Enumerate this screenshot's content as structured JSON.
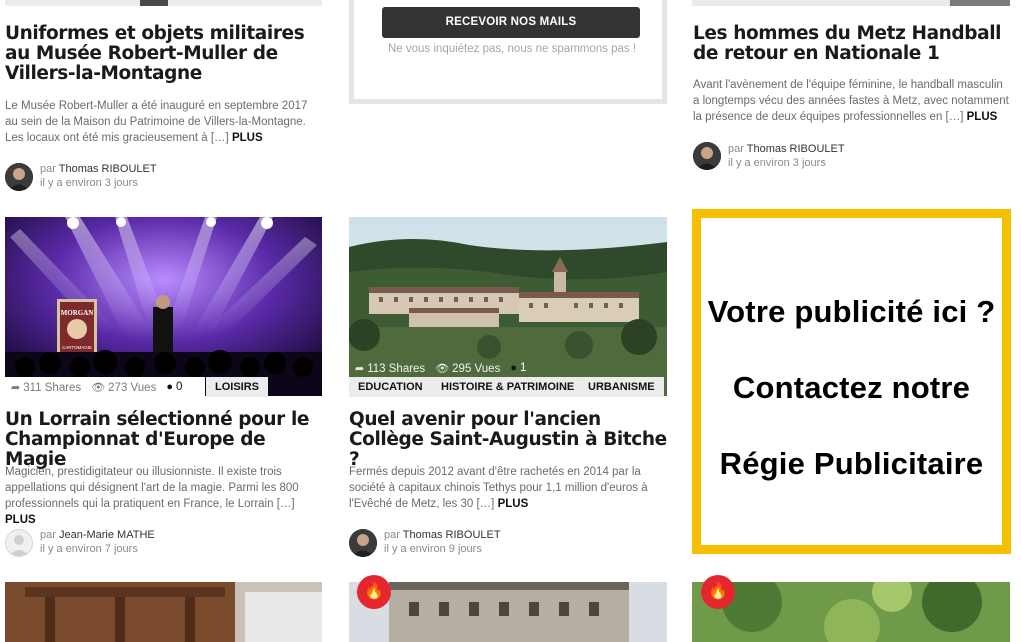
{
  "cards": {
    "col1_top": {
      "title": "Uniformes et objets militaires au Musée Robert-Muller de Villers-la-Montagne",
      "excerpt": "Le Musée Robert-Muller a été inauguré en septembre 2017 au sein de la Maison du Patrimoine de Villers-la-Montagne. Les locaux ont été mis gracieusement à […]",
      "more": "PLUS",
      "by": "par",
      "author": "Thomas RIBOULET",
      "time": "il y a environ 3 jours"
    },
    "col3_top": {
      "title": "Les hommes du Metz Handball de retour en Nationale 1",
      "excerpt": "Avant l'avènement de l'équipe féminine, le handball masculin a longtemps vécu des années fastes à Metz, avec notamment la présence de deux équipes professionnelles en […]",
      "more": "PLUS",
      "by": "par",
      "author": "Thomas RIBOULET",
      "time": "il y a environ 3 jours"
    },
    "magic": {
      "shares": "311 Shares",
      "views": "273 Vues",
      "comments": "0",
      "tag": "LOISIRS",
      "title": "Un Lorrain sélectionné pour le Championnat d'Europe de Magie",
      "excerpt": "Magicien, prestidigitateur ou illusionniste. Il existe trois appellations qui désignent l'art de la magie. Parmi les 800 professionnels qui la pratiquent en France, le Lorrain […]",
      "more": "PLUS",
      "by": "par",
      "author": "Jean-Marie MATHE",
      "time": "il y a environ 7 jours",
      "poster": "MORGAN",
      "poster_sub": "CARTOMAGIE"
    },
    "bitche": {
      "shares": "113 Shares",
      "views": "295 Vues",
      "comments": "1",
      "tags": [
        "EDUCATION",
        "HISTOIRE & PATRIMOINE",
        "URBANISME"
      ],
      "title": "Quel avenir pour l'ancien Collège Saint-Augustin à Bitche ?",
      "excerpt": "Fermés depuis 2012 avant d'être rachetés en 2014 par la société à capitaux chinois Tethys pour 1,1 million d'euros à l'Evêché de Metz, les 30 […]",
      "more": "PLUS",
      "by": "par",
      "author": "Thomas RIBOULET",
      "time": "il y a environ 9 jours"
    }
  },
  "newsletter": {
    "button": "RECEVOIR NOS MAILS",
    "note": "Ne vous inquiétez pas, nous ne spammons pas !"
  },
  "ad": {
    "line1": "Votre publicité ici ?",
    "line2": "Contactez notre",
    "line3": "Régie Publicitaire"
  },
  "colors": {
    "accent": "#f5c000",
    "hot": "#e5272d"
  }
}
